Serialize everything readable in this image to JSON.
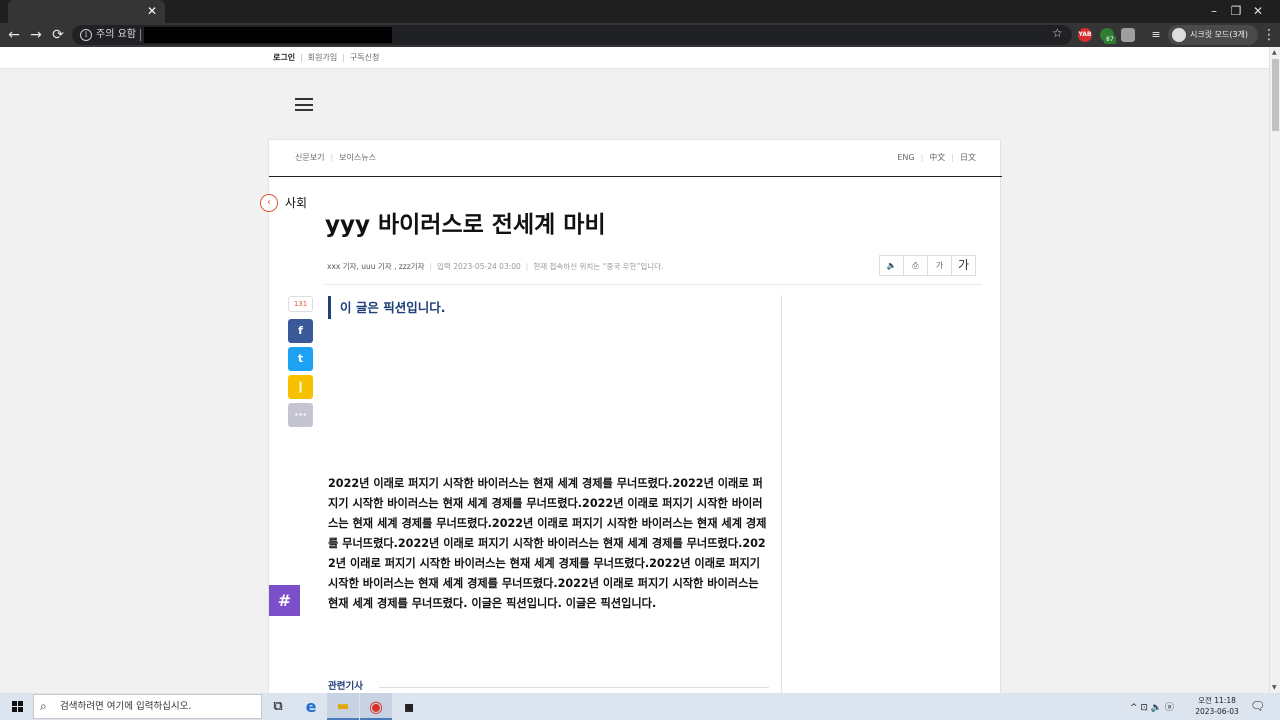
{
  "browser": {
    "tab": {
      "close_glyph": "✕"
    },
    "window_controls": {
      "minimize": "–",
      "restore": "❐",
      "close": "✕"
    },
    "nav": {
      "back": "←",
      "forward": "→",
      "reload": "⟳"
    },
    "omnibox": {
      "security_label": "주의 요함",
      "info_icon": "i",
      "star": "☆"
    },
    "extensions": [
      {
        "name": "yab-extension-icon",
        "label": "YAB",
        "color": "#d32f2f"
      },
      {
        "name": "green-extension-icon",
        "label": "",
        "color": "#2e7d32",
        "badge": "87"
      },
      {
        "name": "gray-extension-icon",
        "label": "",
        "color": "#9e9e9e"
      }
    ],
    "profile_label": "시크릿 모드(3개)",
    "menu_glyph": "⋮"
  },
  "page": {
    "top_links": {
      "login": "로그인",
      "signup": "회원가입",
      "subscribe": "구독신청"
    },
    "subnav": {
      "left": [
        "신문보기",
        "보이스뉴스"
      ],
      "right": [
        "ENG",
        "中文",
        "日文"
      ]
    },
    "section": {
      "label": "사회",
      "icon": "‹"
    },
    "headline": "yyy 바이러스로 전세계 마비",
    "byline": {
      "authors": "xxx 기자, uuu 기자 , zzz기자",
      "date": "입력 2023-05-24 03:00",
      "location": "현재 접속하신 위치는 “중국 우한”입니다."
    },
    "tools": {
      "speaker": "🔈",
      "print": "⎙",
      "font_small": "가",
      "font_large": "가"
    },
    "share": {
      "count": "131",
      "facebook": "f",
      "twitter": "t",
      "kakao": "❙",
      "more": "···"
    },
    "hash_button": "#",
    "lead": "이 글은 픽션입니다.",
    "body": "2022년 이래로 퍼지기 시작한 바이러스는 현재 세계 경제를 무너뜨렸다.2022년 이래로 퍼지기 시작한 바이러스는 현재 세계 경제를 무너뜨렸다.2022년 이래로 퍼지기 시작한 바이러스는 현재 세계 경제를 무너뜨렸다.2022년 이래로 퍼지기 시작한 바이러스는 현재 세계 경제를 무너뜨렸다.2022년 이래로 퍼지기 시작한 바이러스는 현재 세계 경제를 무너뜨렸다.2022년 이래로 퍼지기 시작한 바이러스는 현재 세계 경제를 무너뜨렸다.2022년 이래로 퍼지기 시작한 바이러스는 현재 세계 경제를 무너뜨렸다.2022년 이래로 퍼지기 시작한 바이러스는 현재 세계 경제를 무너뜨렸다. 이글은 픽션입니다. 이글은 픽션입니다.",
    "related_label": "관련기사",
    "colors": {
      "accent_navy": "#1f3f78",
      "accent_orange": "#e05a3a",
      "hash_purple": "#7a4fc9",
      "facebook": "#3b5998",
      "twitter": "#1da1f2",
      "kakao": "#f7c100",
      "more": "#c5c5d2"
    }
  },
  "taskbar": {
    "search_placeholder": "검색하려면 여기에 입력하십시오.",
    "search_glyph": "⌕",
    "apps": [
      {
        "name": "task-view-icon",
        "glyph": "⧉"
      },
      {
        "name": "edge-icon",
        "glyph": "e"
      },
      {
        "name": "file-explorer-icon",
        "glyph": "▬"
      },
      {
        "name": "chrome-icon",
        "glyph": "◉"
      },
      {
        "name": "sticky-app-icon",
        "glyph": "▪"
      }
    ],
    "tray": "^  ⊡  🔈  ⓐ",
    "clock": {
      "time": "오전 11:18",
      "date": "2023-06-03"
    },
    "notification_glyph": "🗨"
  }
}
